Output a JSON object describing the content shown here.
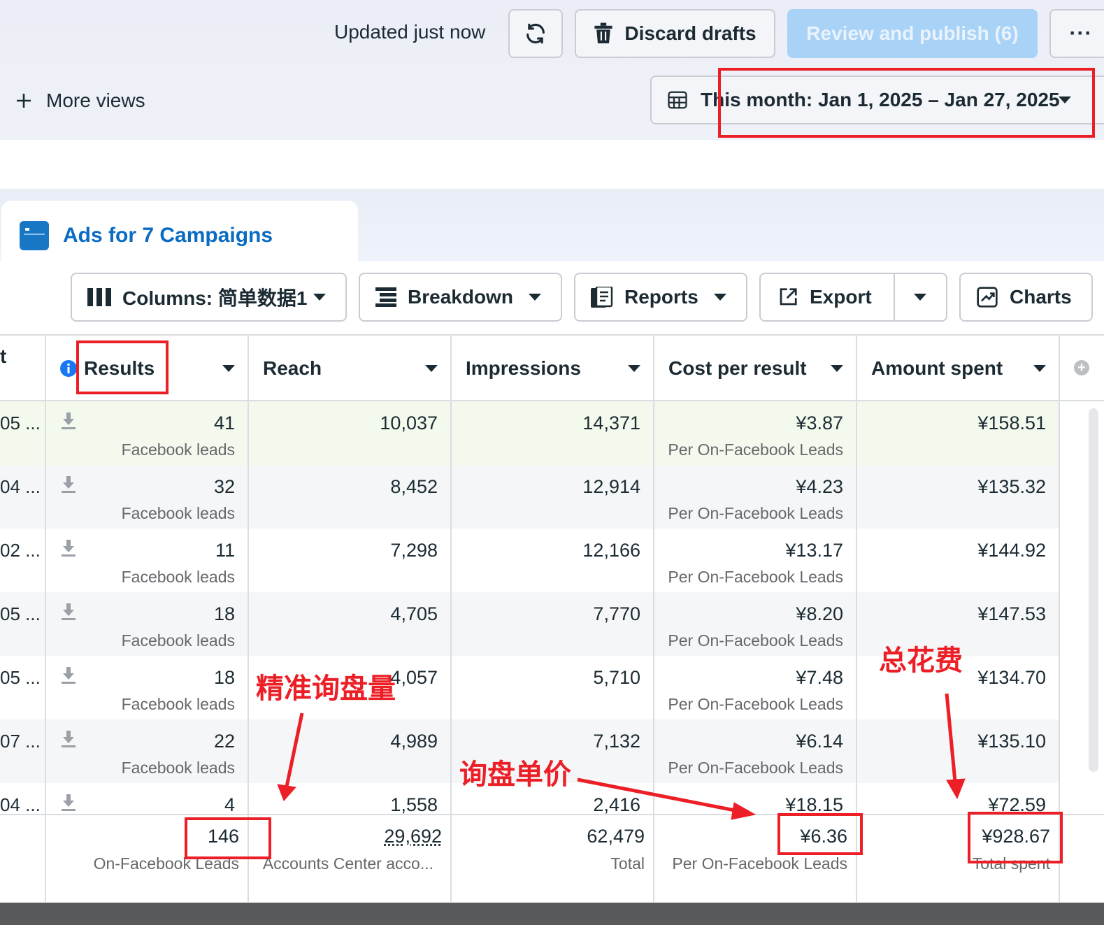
{
  "header": {
    "updated_text": "Updated just now",
    "discard_label": "Discard drafts",
    "publish_label": "Review and publish (6)",
    "more_views_label": "More views",
    "date_range": "This month: Jan 1, 2025 – Jan 27, 2025"
  },
  "tab": {
    "title": "Ads for 7 Campaigns"
  },
  "toolbar": {
    "columns_label": "Columns: 简单数据1",
    "breakdown_label": "Breakdown",
    "reports_label": "Reports",
    "export_label": "Export",
    "charts_label": "Charts"
  },
  "table": {
    "headers": {
      "results": "Results",
      "reach": "Reach",
      "impressions": "Impressions",
      "cost_per_result": "Cost per result",
      "amount_spent": "Amount spent"
    },
    "rows": [
      {
        "prefix": "05 ...",
        "results": "41",
        "results_sub": "Facebook leads",
        "reach": "10,037",
        "impressions": "14,371",
        "cost": "¥3.87",
        "cost_sub": "Per On-Facebook Leads",
        "spent": "¥158.51"
      },
      {
        "prefix": "04 ...",
        "results": "32",
        "results_sub": "Facebook leads",
        "reach": "8,452",
        "impressions": "12,914",
        "cost": "¥4.23",
        "cost_sub": "Per On-Facebook Leads",
        "spent": "¥135.32"
      },
      {
        "prefix": "02 ...",
        "results": "11",
        "results_sub": "Facebook leads",
        "reach": "7,298",
        "impressions": "12,166",
        "cost": "¥13.17",
        "cost_sub": "Per On-Facebook Leads",
        "spent": "¥144.92"
      },
      {
        "prefix": "05 ...",
        "results": "18",
        "results_sub": "Facebook leads",
        "reach": "4,705",
        "impressions": "7,770",
        "cost": "¥8.20",
        "cost_sub": "Per On-Facebook Leads",
        "spent": "¥147.53"
      },
      {
        "prefix": "05 ...",
        "results": "18",
        "results_sub": "Facebook leads",
        "reach": "4,057",
        "impressions": "5,710",
        "cost": "¥7.48",
        "cost_sub": "Per On-Facebook Leads",
        "spent": "¥134.70"
      },
      {
        "prefix": "07 ...",
        "results": "22",
        "results_sub": "Facebook leads",
        "reach": "4,989",
        "impressions": "7,132",
        "cost": "¥6.14",
        "cost_sub": "Per On-Facebook Leads",
        "spent": "¥135.10"
      },
      {
        "prefix": "04 ...",
        "results": "4",
        "results_sub": "",
        "reach": "1,558",
        "impressions": "2,416",
        "cost": "¥18.15",
        "cost_sub": "",
        "spent": "¥72.59"
      }
    ],
    "totals": {
      "results": "146",
      "results_sub": "On-Facebook Leads",
      "reach": "29,692",
      "reach_sub": "Accounts Center acco...",
      "impressions": "62,479",
      "impressions_sub": "Total",
      "cost": "¥6.36",
      "cost_sub": "Per On-Facebook Leads",
      "spent": "¥928.67",
      "spent_sub": "Total spent"
    }
  },
  "annotations": {
    "leads": "精准询盘量",
    "unit_price": "询盘单价",
    "total_spend": "总花费"
  },
  "colors": {
    "accent_blue": "#0a6bc2",
    "publish_disabled": "#a9d2f7",
    "annotation_red": "#ec1f26",
    "highlight_row": "#f3f9ec"
  }
}
